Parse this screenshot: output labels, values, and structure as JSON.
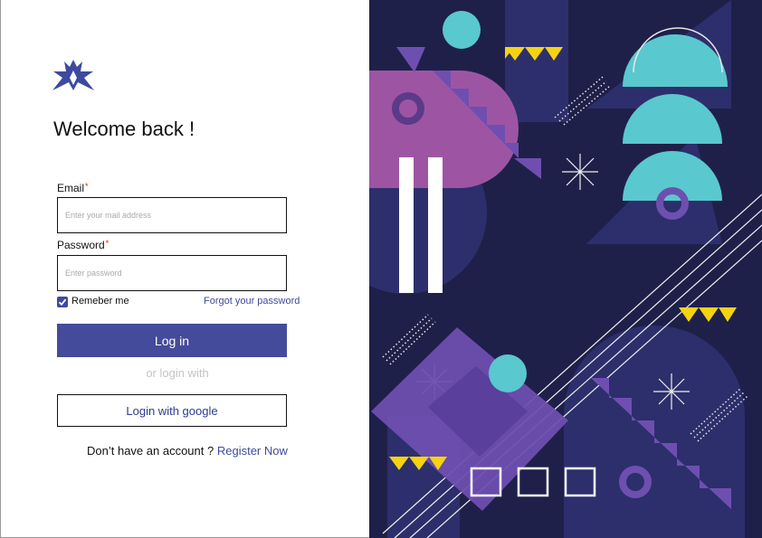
{
  "login": {
    "title": "Welcome back !",
    "email_label": "Email",
    "email_placeholder": "Enter your mail address",
    "password_label": "Password",
    "password_placeholder": "Enter password",
    "required_marker": "*",
    "remember_label": "Remeber me",
    "remember_checked": true,
    "forgot_label": "Forgot your password",
    "login_button": "Log in",
    "or_text": "or login with",
    "google_button": "Login with google",
    "no_account_text": "Don’t have an account ?",
    "register_link": "Register Now"
  },
  "icons": {
    "logo": "brand-logo-icon",
    "checkbox": "checkmark-icon"
  },
  "colors": {
    "accent": "#444b9a",
    "link": "#3d4aa0",
    "required": "#e01a1a",
    "art_background": "#1f2049",
    "art_purple": "#9d55a3",
    "art_teal": "#5ac8cf",
    "art_yellow": "#f5d311",
    "art_violet": "#6e4fb0"
  }
}
